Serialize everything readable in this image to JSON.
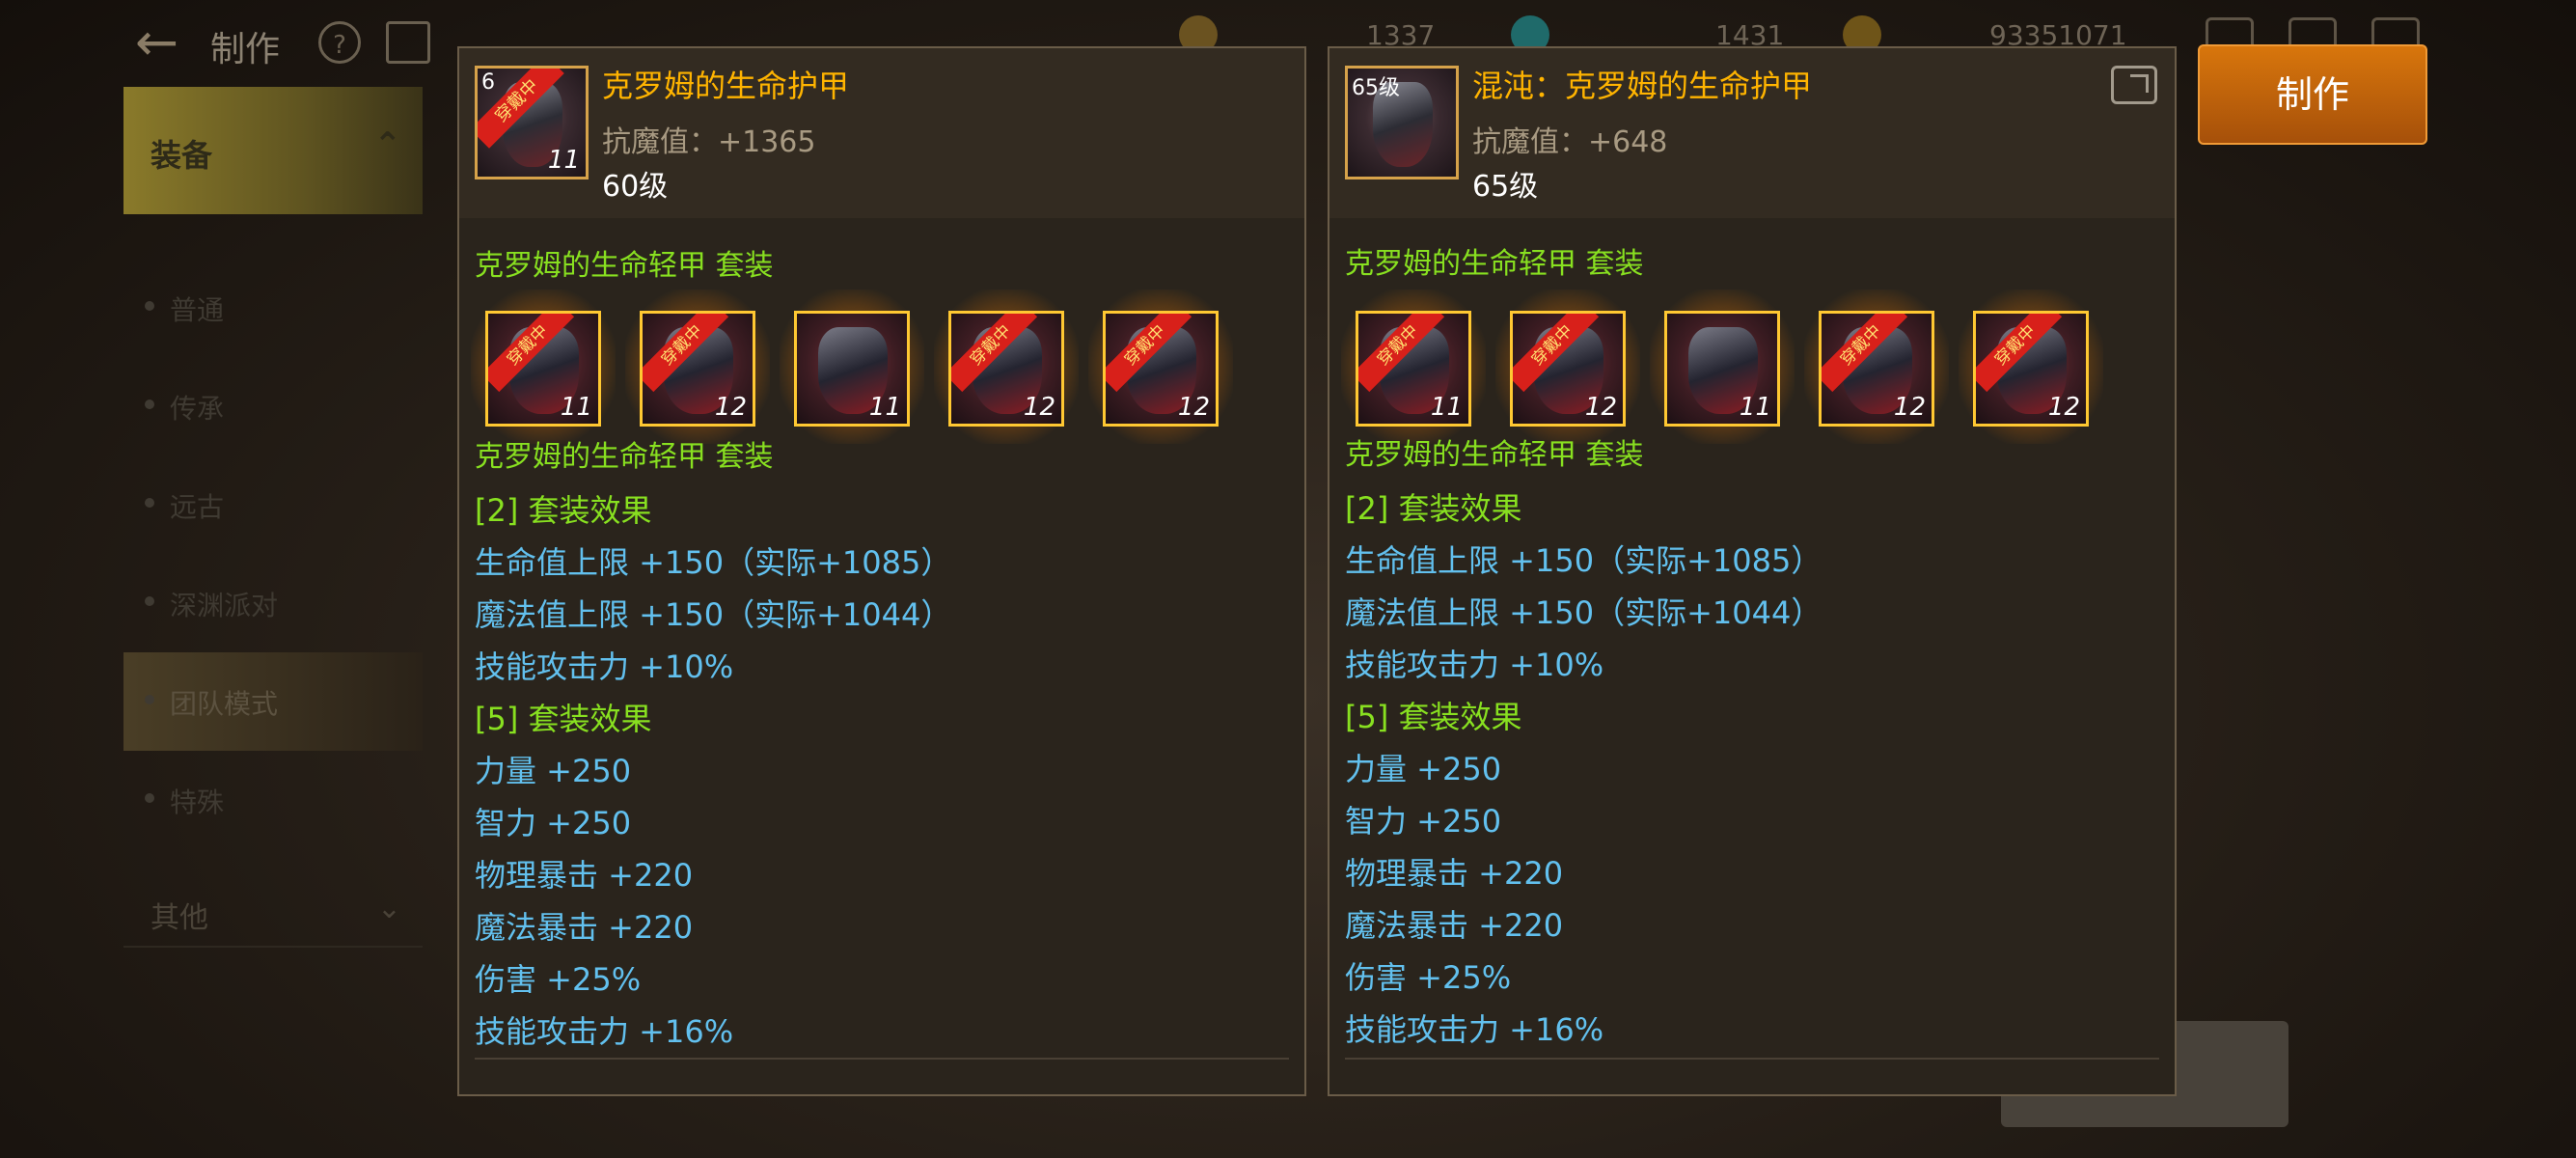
{
  "header": {
    "title": "制作",
    "resources": [
      {
        "value": "1337",
        "icon": "key-icon",
        "color": "#8a6a20"
      },
      {
        "value": "1431",
        "icon": "crystal-icon",
        "color": "#2a8a8a"
      },
      {
        "value": "93351071",
        "icon": "gold-coin-icon",
        "color": "#8a6a18"
      }
    ]
  },
  "sidebar": {
    "category": "装备",
    "items": [
      {
        "label": "普通"
      },
      {
        "label": "传承"
      },
      {
        "label": "远古"
      },
      {
        "label": "深渊派对"
      },
      {
        "label": "团队模式"
      },
      {
        "label": "特殊"
      }
    ],
    "other": "其他"
  },
  "make_button": "制作",
  "panels": [
    {
      "name": "克罗姆的生命护甲",
      "stat": "抗魔值：+1365",
      "level": "60级",
      "icon_level_tag": "6",
      "icon_ribbon": "穿戴中",
      "icon_enhance": "11",
      "has_share": false,
      "set_title_top": "克罗姆的生命轻甲  套装",
      "set_title_bottom": "克罗姆的生命轻甲  套装",
      "set_items": [
        {
          "ribbon": "穿戴中",
          "enhance": "11"
        },
        {
          "ribbon": "穿戴中",
          "enhance": "12"
        },
        {
          "ribbon": "",
          "enhance": "11"
        },
        {
          "ribbon": "穿戴中",
          "enhance": "12"
        },
        {
          "ribbon": "穿戴中",
          "enhance": "12"
        }
      ],
      "effect2_title": "[2] 套装效果",
      "effect2": [
        "生命值上限 +150（实际+1085）",
        "魔法值上限 +150（实际+1044）",
        "技能攻击力 +10%"
      ],
      "effect5_title": "[5] 套装效果",
      "effect5": [
        "力量 +250",
        "智力 +250",
        "物理暴击 +220",
        "魔法暴击 +220",
        "伤害 +25%",
        "技能攻击力 +16%"
      ]
    },
    {
      "name": "混沌：克罗姆的生命护甲",
      "stat": "抗魔值：+648",
      "level": "65级",
      "icon_level_tag": "65级",
      "icon_ribbon": "",
      "icon_enhance": "",
      "has_share": true,
      "set_title_top": "克罗姆的生命轻甲  套装",
      "set_title_bottom": "克罗姆的生命轻甲  套装",
      "set_items": [
        {
          "ribbon": "穿戴中",
          "enhance": "11"
        },
        {
          "ribbon": "穿戴中",
          "enhance": "12"
        },
        {
          "ribbon": "",
          "enhance": "11"
        },
        {
          "ribbon": "穿戴中",
          "enhance": "12"
        },
        {
          "ribbon": "穿戴中",
          "enhance": "12"
        }
      ],
      "effect2_title": "[2] 套装效果",
      "effect2": [
        "生命值上限 +150（实际+1085）",
        "魔法值上限 +150（实际+1044）",
        "技能攻击力 +10%"
      ],
      "effect5_title": "[5] 套装效果",
      "effect5": [
        "力量 +250",
        "智力 +250",
        "物理暴击 +220",
        "魔法暴击 +220",
        "伤害 +25%",
        "技能攻击力 +16%"
      ]
    }
  ]
}
